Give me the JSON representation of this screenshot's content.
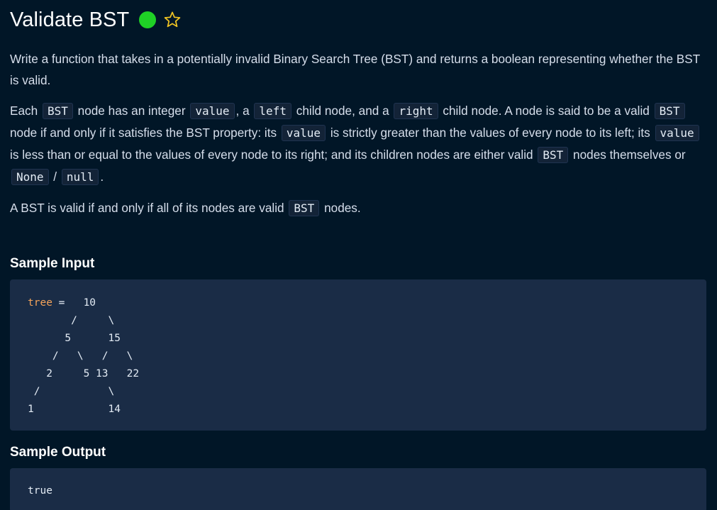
{
  "header": {
    "title": "Validate BST",
    "status_color": "#1fd126",
    "status_icon": "green-dot-icon",
    "favorite_icon": "star-outline-icon"
  },
  "description": {
    "p1": "Write a function that takes in a potentially invalid Binary Search Tree (BST) and returns a boolean representing whether the BST is valid.",
    "p2": {
      "t1": "Each ",
      "c1": "BST",
      "t2": " node has an integer ",
      "c2": "value",
      "t3": ", a ",
      "c3": "left",
      "t4": " child node, and a ",
      "c4": "right",
      "t5": " child node. A node is said to be a valid ",
      "c5": "BST",
      "t6": " node if and only if it satisfies the BST property: its ",
      "c6": "value",
      "t7": " is strictly greater than the values of every node to its left; its ",
      "c7": "value",
      "t8": " is less than or equal to the values of every node to its right; and its children nodes are either valid ",
      "c8": "BST",
      "t9": " nodes themselves or ",
      "c9": "None",
      "t10": " / ",
      "c10": "null",
      "t11": "."
    },
    "p3": {
      "t1": "A BST is valid if and only if all of its nodes are valid ",
      "c1": "BST",
      "t2": " nodes."
    }
  },
  "sample_input": {
    "title": "Sample Input",
    "var": "tree",
    "assign": " =   ",
    "code_rest": "10\n       /     \\\n      5      15\n    /   \\   /   \\\n   2     5 13   22\n /           \\\n1            14"
  },
  "sample_output": {
    "title": "Sample Output",
    "code": "true"
  }
}
